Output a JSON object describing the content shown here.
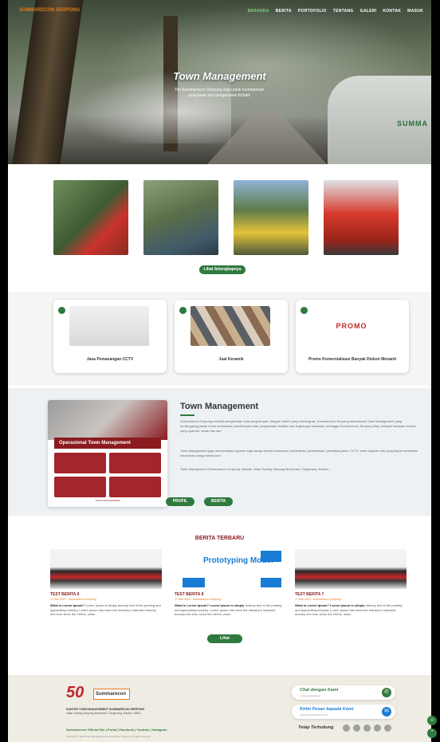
{
  "header": {
    "logo": "SUMMARECON SERPONG",
    "nav": [
      "BERANDA",
      "BERITA",
      "PORTOFOLIO",
      "TENTANG",
      "GALERI",
      "KONTAK",
      "MASUK"
    ]
  },
  "hero": {
    "title": "Town Management",
    "subtitle": "Tim Summarecon Serpong siap untuk memberikan pelayanan dan pengelolaan terbaik",
    "truck_logo": "SUMMA"
  },
  "gallery": {
    "more_label": "Lihat Selengkapnya"
  },
  "promos": [
    {
      "label": "Jasa Pemasangan CCTV"
    },
    {
      "label": "Jual Keramik"
    },
    {
      "label": "Promo Komersialisasi Banyak Diskon Menanti",
      "logo": "PROMO"
    }
  ],
  "about": {
    "card_banner": "TOWN MANAGEMENT",
    "card_bar": "Operasional Town Management",
    "title": "Town Management",
    "p1": "Summarecon Serpong memiliki pengelolaan kota yang terpadu dengan sistem yang terintegrasi. Summarecon Serpong membentuk Town Management yang bertanggung jawab untuk melakukan pemeliharaan dan pengelolaan fasilitas dan lingkungan kawasan, sehingga Summarecon Serpong tetap menjadi kawasan hunian yang nyaman, aman dan asri.",
    "p2": "Town Management juga menyediakan layanan bagi warga seperti keamanan, kebersihan, pertamanan, perbaikan jalan, CCTV, serta layanan lain yang dapat membantu kebutuhan warga sehari-hari.",
    "p3": "Town Management Summarecon Serpong. Alamat: Jalan Gading Serpong Boulevard, Tangerang, Banten.",
    "profile_label": "PROFIL",
    "news_label": "BERITA"
  },
  "news": {
    "heading": "BERITA TERBARU",
    "items": [
      {
        "title": "TEST BERITA 9",
        "date": "17 Mar 2022 - Summarecon Serpong",
        "lead": "What is Lorem Ipsum?",
        "text": "Lorem Ipsum is simply dummy text of the printing and typesetting industry. Lorem Ipsum has been the industry's standard dummy text ever since the 1500s, when"
      },
      {
        "title": "TEST BERITA 8",
        "date": "17 Mar 2022 - Summarecon Serpong",
        "lead": "What is Lorem Ipsum? Lorem Ipsum is simply",
        "text": "dummy text of the printing and typesetting industry. Lorem Ipsum has been the industry's standard dummy text ever since the 1500s, when",
        "diagram": "Prototyping Model"
      },
      {
        "title": "TEST BERITA 7",
        "date": "17 Mar 2022 - Summarecon Serpong",
        "lead": "What is Lorem Ipsum? Lorem Ipsum is simply",
        "text": "dummy text of the printing and typesetting industry. Lorem Ipsum has been the industry's standard dummy text ever since the 1500s, when"
      }
    ],
    "more_label": "Lihat Selengkapnya"
  },
  "footer": {
    "anniversary": "50",
    "brand": "Summarecon",
    "office": "KANTOR TOWN MANAGEMENT SUMMARECON SERPONG",
    "address": "Jalan Gading Serpong Boulevard, Tangerang, Banten 15810",
    "links": "Summarecon Official Site | Portal | Facebook | Youtube | Instagram",
    "copyright": "Copyright © 2022 Town Management Summarecon Serpong. All rights reserved.",
    "chat_title": "Chat dengan Kami",
    "chat_sub": "Layanan pelanggan",
    "mail_title": "Kirim Pesan kepada Kami",
    "mail_sub": "Kirimkan pertanyaan anda",
    "follow": "Tetap Terhubung"
  },
  "colors": {
    "brand_green": "#2f7a3e",
    "brand_red": "#8b1b1f",
    "accent_orange": "#e07b1c"
  }
}
